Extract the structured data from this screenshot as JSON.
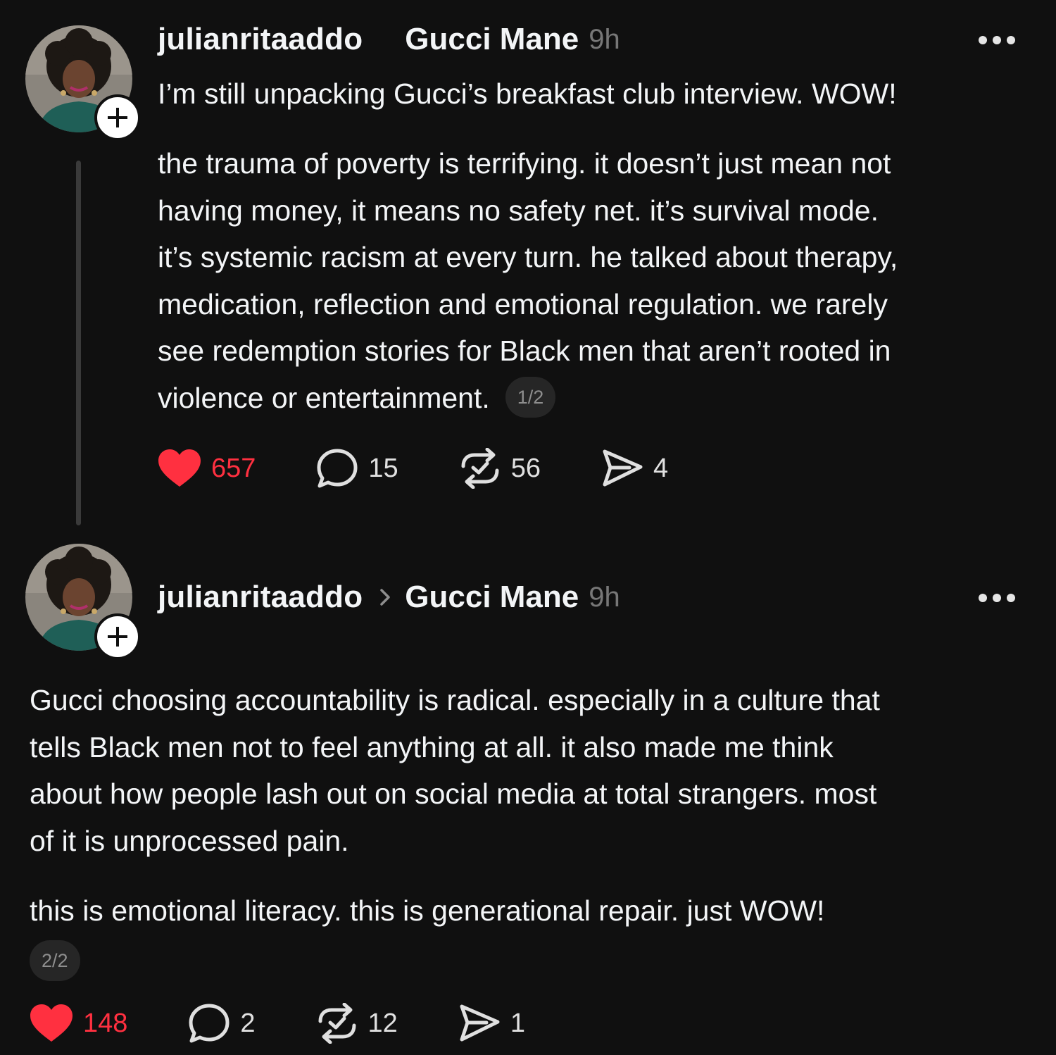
{
  "colors": {
    "background": "#101010",
    "text": "#f3f5f7",
    "muted": "#777777",
    "like": "#ff3040",
    "pill_bg": "#262626"
  },
  "posts": [
    {
      "username": "julianritaaddo",
      "reply_to": "Gucci Mane",
      "time": "9h",
      "paragraphs": [
        [
          "I’m still unpacking Gucci’s breakfast club interview. WOW!"
        ],
        [
          "the trauma of poverty is terrifying. it doesn’t just mean not",
          "having money, it means no safety net. it’s survival mode.",
          "it’s systemic racism at every turn. he talked about therapy,",
          "medication, reflection and emotional regulation. we rarely",
          "see redemption stories for Black men that aren’t rooted in",
          "violence or entertainment."
        ]
      ],
      "page_indicator": "1/2",
      "likes": "657",
      "comments": "15",
      "reposts": "56",
      "shares": "4",
      "liked": true
    },
    {
      "username": "julianritaaddo",
      "reply_to": "Gucci Mane",
      "time": "9h",
      "paragraphs": [
        [
          "Gucci choosing accountability is radical. especially in a culture that",
          "tells Black men not to feel anything at all. it also made me think",
          "about how people lash out on social media at total strangers. most",
          "of it is unprocessed pain."
        ],
        [
          "this is emotional literacy. this is generational repair. just WOW!"
        ]
      ],
      "page_indicator": "2/2",
      "likes": "148",
      "comments": "2",
      "reposts": "12",
      "shares": "1",
      "liked": true
    }
  ],
  "icons": {
    "avatar": "profile-photo",
    "follow": "plus-icon",
    "more": "more-horizontal-icon",
    "like": "heart-icon",
    "comment": "comment-icon",
    "repost": "repost-icon",
    "share": "share-icon",
    "reply_arrow": "chevron-right-icon"
  }
}
